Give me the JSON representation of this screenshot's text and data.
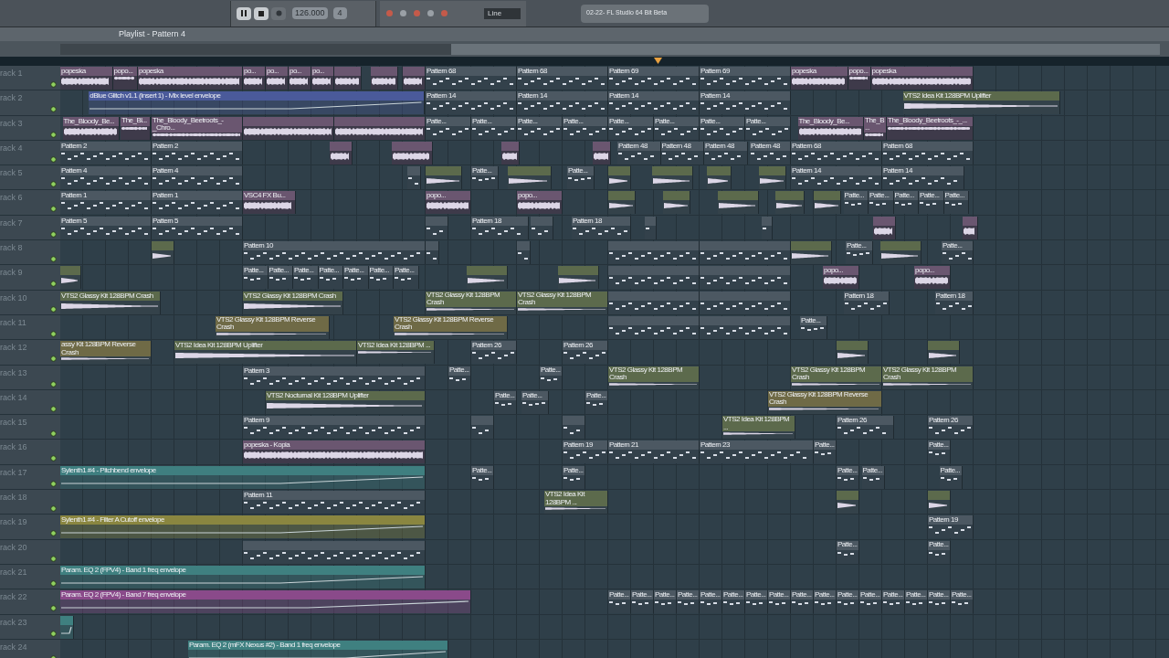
{
  "toolbar": {
    "tempo": "126.000",
    "pattern": "4",
    "snap": "Line",
    "hint": "02-22- FL Studio 64 Bit Beta"
  },
  "playlist": {
    "title": "Playlist - Pattern 4",
    "tracks": [
      {
        "name": "rack 1",
        "clips": [
          {
            "kind": "audio",
            "label": "popeska"
          },
          {
            "kind": "audio",
            "label": "popo..."
          },
          {
            "kind": "audio",
            "label": "popeska"
          },
          {
            "kind": "audio",
            "label": "po..."
          },
          {
            "kind": "audio",
            "label": "po..."
          },
          {
            "kind": "audio",
            "label": "po..."
          },
          {
            "kind": "audio",
            "label": "po..."
          },
          {
            "kind": "audio"
          },
          {
            "kind": "audio"
          },
          {
            "kind": "audio"
          },
          {
            "kind": "pattern",
            "label": "Pattern 68"
          },
          {
            "kind": "pattern",
            "label": "Pattern 68"
          },
          {
            "kind": "pattern",
            "label": "Pattern 69"
          },
          {
            "kind": "pattern",
            "label": "Pattern 69"
          },
          {
            "kind": "audio",
            "label": "popeska"
          },
          {
            "kind": "audio",
            "label": "popo..."
          },
          {
            "kind": "audio",
            "label": "popeska"
          }
        ]
      },
      {
        "name": "rack 2",
        "clips": [
          {
            "kind": "automation",
            "color": "#4a5a9a",
            "label": "dBlue Glitch v1.1 (Insert 1) - Mix level envelope"
          },
          {
            "kind": "pattern",
            "label": "Pattern 14"
          },
          {
            "kind": "pattern",
            "label": "Pattern 14"
          },
          {
            "kind": "pattern",
            "label": "Pattern 14"
          },
          {
            "kind": "pattern",
            "label": "Pattern 14"
          },
          {
            "kind": "sample",
            "label": "VTS2 Idea Kit 128BPM Uplifter"
          }
        ]
      },
      {
        "name": "rack 3",
        "clips": [
          {
            "kind": "audio",
            "label": "The_Bloody_Be..."
          },
          {
            "kind": "audio",
            "label": "The_Bl..."
          },
          {
            "kind": "audio",
            "label": "The_Bloody_Beetroots_-_Chro..."
          },
          {
            "kind": "audio"
          },
          {
            "kind": "audio"
          },
          {
            "kind": "pattern",
            "label": "Patte..."
          },
          {
            "kind": "pattern",
            "label": "Patte..."
          },
          {
            "kind": "pattern",
            "label": "Patte..."
          },
          {
            "kind": "pattern",
            "label": "Patte..."
          },
          {
            "kind": "pattern",
            "label": "Patte..."
          },
          {
            "kind": "pattern",
            "label": "Patte..."
          },
          {
            "kind": "pattern",
            "label": "Patte..."
          },
          {
            "kind": "pattern",
            "label": "Patte..."
          },
          {
            "kind": "audio",
            "label": "The_Bloody_Be..."
          },
          {
            "kind": "audio",
            "label": "The_B..."
          },
          {
            "kind": "audio",
            "label": "The_Bloody_Beetroots_-_..."
          }
        ]
      },
      {
        "name": "rack 4",
        "clips": [
          {
            "kind": "pattern",
            "label": "Pattern 2"
          },
          {
            "kind": "pattern",
            "label": "Pattern 2"
          },
          {
            "kind": "audio"
          },
          {
            "kind": "audio"
          },
          {
            "kind": "audio"
          },
          {
            "kind": "audio"
          },
          {
            "kind": "pattern",
            "label": "Pattern 48"
          },
          {
            "kind": "pattern",
            "label": "Pattern 48"
          },
          {
            "kind": "pattern",
            "label": "Pattern 48"
          },
          {
            "kind": "pattern",
            "label": "Pattern 48"
          },
          {
            "kind": "pattern",
            "label": "Pattern 68"
          },
          {
            "kind": "pattern",
            "label": "Pattern 68"
          }
        ]
      },
      {
        "name": "rack 5",
        "clips": [
          {
            "kind": "pattern",
            "label": "Pattern 4"
          },
          {
            "kind": "pattern",
            "label": "Pattern 4"
          },
          {
            "kind": "pattern"
          },
          {
            "kind": "sample"
          },
          {
            "kind": "pattern",
            "label": "Patte..."
          },
          {
            "kind": "sample"
          },
          {
            "kind": "pattern",
            "label": "Patte..."
          },
          {
            "kind": "sample"
          },
          {
            "kind": "sample"
          },
          {
            "kind": "sample"
          },
          {
            "kind": "sample"
          },
          {
            "kind": "pattern",
            "label": "Pattern 14"
          },
          {
            "kind": "pattern",
            "label": "Pattern 14"
          }
        ]
      },
      {
        "name": "rack 6",
        "clips": [
          {
            "kind": "pattern",
            "label": "Pattern 1"
          },
          {
            "kind": "pattern",
            "label": "Pattern 1"
          },
          {
            "kind": "audio",
            "label": "VSC4 FX Bu..."
          },
          {
            "kind": "audio",
            "label": "popo..."
          },
          {
            "kind": "audio",
            "label": "popo..."
          },
          {
            "kind": "sample"
          },
          {
            "kind": "sample"
          },
          {
            "kind": "sample"
          },
          {
            "kind": "sample"
          },
          {
            "kind": "sample"
          },
          {
            "kind": "pattern",
            "label": "Patte..."
          },
          {
            "kind": "pattern",
            "label": "Patte..."
          },
          {
            "kind": "pattern",
            "label": "Patte..."
          },
          {
            "kind": "pattern",
            "label": "Patte..."
          },
          {
            "kind": "pattern",
            "label": "Patte..."
          }
        ]
      },
      {
        "name": "rack 7",
        "clips": [
          {
            "kind": "pattern",
            "label": "Pattern 5"
          },
          {
            "kind": "pattern",
            "label": "Pattern 5"
          },
          {
            "kind": "pattern"
          },
          {
            "kind": "pattern",
            "label": "Pattern 18"
          },
          {
            "kind": "pattern"
          },
          {
            "kind": "pattern",
            "label": "Pattern 18"
          },
          {
            "kind": "pattern"
          },
          {
            "kind": "pattern"
          },
          {
            "kind": "audio"
          },
          {
            "kind": "audio"
          }
        ]
      },
      {
        "name": "rack 8",
        "clips": [
          {
            "kind": "sample"
          },
          {
            "kind": "pattern",
            "label": "Pattern 10"
          },
          {
            "kind": "pattern"
          },
          {
            "kind": "pattern"
          },
          {
            "kind": "pattern"
          },
          {
            "kind": "pattern"
          },
          {
            "kind": "sample"
          },
          {
            "kind": "pattern",
            "label": "Patte..."
          },
          {
            "kind": "sample"
          },
          {
            "kind": "pattern",
            "label": "Patte..."
          }
        ]
      },
      {
        "name": "rack 9",
        "clips": [
          {
            "kind": "sample"
          },
          {
            "kind": "pattern",
            "label": "Patte..."
          },
          {
            "kind": "pattern",
            "label": "Patte..."
          },
          {
            "kind": "pattern",
            "label": "Patte..."
          },
          {
            "kind": "pattern",
            "label": "Patte..."
          },
          {
            "kind": "pattern",
            "label": "Patte..."
          },
          {
            "kind": "pattern",
            "label": "Patte..."
          },
          {
            "kind": "pattern",
            "label": "Patte..."
          },
          {
            "kind": "sample"
          },
          {
            "kind": "sample"
          },
          {
            "kind": "pattern"
          },
          {
            "kind": "pattern"
          },
          {
            "kind": "audio",
            "label": "popo..."
          },
          {
            "kind": "audio",
            "label": "popo..."
          }
        ]
      },
      {
        "name": "rack 10",
        "clips": [
          {
            "kind": "sample",
            "label": "VTS2 Glassy Kit 128BPM Crash"
          },
          {
            "kind": "sample",
            "label": "VTS2 Glassy Kit 128BPM Crash"
          },
          {
            "kind": "sample",
            "label": "VTS2 Glassy Kit 128BPM Crash"
          },
          {
            "kind": "sample",
            "label": "VTS2 Glassy Kit 128BPM Crash"
          },
          {
            "kind": "pattern"
          },
          {
            "kind": "pattern"
          },
          {
            "kind": "pattern",
            "label": "Pattern 18"
          },
          {
            "kind": "pattern",
            "label": "Pattern 18"
          }
        ]
      },
      {
        "name": "rack 11",
        "clips": [
          {
            "kind": "reverse",
            "label": "VTS2 Glassy Kit 128BPM Reverse Crash"
          },
          {
            "kind": "reverse",
            "label": "VTS2 Glassy Kit 128BPM Reverse Crash"
          },
          {
            "kind": "pattern"
          },
          {
            "kind": "pattern"
          },
          {
            "kind": "pattern",
            "label": "Patte..."
          }
        ]
      },
      {
        "name": "rack 12",
        "clips": [
          {
            "kind": "reverse",
            "label": "assy Kit 128BPM Reverse Crash"
          },
          {
            "kind": "sample",
            "label": "VTS2 Idea Kit 128BPM Uplifter"
          },
          {
            "kind": "sample",
            "label": "VTS2 Idea Kit 128BPM ..."
          },
          {
            "kind": "pattern",
            "label": "Pattern 26"
          },
          {
            "kind": "pattern",
            "label": "Pattern 26"
          },
          {
            "kind": "sample"
          },
          {
            "kind": "sample"
          }
        ]
      },
      {
        "name": "rack 13",
        "clips": [
          {
            "kind": "pattern",
            "label": "Pattern 3"
          },
          {
            "kind": "pattern",
            "label": "Patte..."
          },
          {
            "kind": "pattern",
            "label": "Patte..."
          },
          {
            "kind": "sample",
            "label": "VTS2 Glassy Kit 128BPM Crash"
          },
          {
            "kind": "sample",
            "label": "VTS2 Glassy Kit 128BPM Crash"
          },
          {
            "kind": "sample",
            "label": "VTS2 Glassy Kit 128BPM Crash"
          }
        ]
      },
      {
        "name": "rack 14",
        "clips": [
          {
            "kind": "sample",
            "label": "VTS2 Nocturnal Kit 128BPM Uplifter"
          },
          {
            "kind": "pattern",
            "label": "Patte..."
          },
          {
            "kind": "pattern",
            "label": "Patte..."
          },
          {
            "kind": "pattern",
            "label": "Patte..."
          },
          {
            "kind": "reverse",
            "label": "VTS2 Glassy Kit 128BPM Reverse Crash"
          }
        ]
      },
      {
        "name": "rack 15",
        "clips": [
          {
            "kind": "pattern",
            "label": "Pattern 9"
          },
          {
            "kind": "pattern"
          },
          {
            "kind": "pattern"
          },
          {
            "kind": "sample",
            "label": "VTS2 Idea Kit 128BPM ..."
          },
          {
            "kind": "pattern",
            "label": "Pattern 26"
          },
          {
            "kind": "pattern",
            "label": "Pattern 26"
          }
        ]
      },
      {
        "name": "rack 16",
        "clips": [
          {
            "kind": "audio",
            "label": "popeska - Kopia"
          },
          {
            "kind": "pattern",
            "label": "Pattern 19"
          },
          {
            "kind": "pattern",
            "label": "Pattern 21"
          },
          {
            "kind": "pattern",
            "label": "Pattern 23"
          },
          {
            "kind": "pattern",
            "label": "Patte..."
          },
          {
            "kind": "pattern",
            "label": "Patte..."
          }
        ]
      },
      {
        "name": "rack 17",
        "clips": [
          {
            "kind": "automation",
            "color": "#3f7f80",
            "label": "Sylenth1 #4 - Pitchbend envelope"
          },
          {
            "kind": "pattern",
            "label": "Patte..."
          },
          {
            "kind": "pattern",
            "label": "Patte..."
          },
          {
            "kind": "pattern",
            "label": "Patte..."
          },
          {
            "kind": "pattern",
            "label": "Patte..."
          },
          {
            "kind": "pattern",
            "label": "Patte..."
          }
        ]
      },
      {
        "name": "rack 18",
        "clips": [
          {
            "kind": "pattern",
            "label": "Pattern 11"
          },
          {
            "kind": "sample",
            "label": "VTS2 Idea Kit 128BPM ..."
          },
          {
            "kind": "sample"
          },
          {
            "kind": "sample"
          }
        ]
      },
      {
        "name": "rack 19",
        "clips": [
          {
            "kind": "automation",
            "color": "#8a8640",
            "label": "Sylenth1 #4 - Filter A Cutoff envelope"
          },
          {
            "kind": "pattern",
            "label": "Pattern 19"
          }
        ]
      },
      {
        "name": "rack 20",
        "clips": [
          {
            "kind": "pattern"
          },
          {
            "kind": "pattern",
            "label": "Patte..."
          },
          {
            "kind": "pattern",
            "label": "Patte..."
          }
        ]
      },
      {
        "name": "rack 21",
        "clips": [
          {
            "kind": "automation",
            "color": "#3f8080",
            "label": "Param. EQ 2 (FPV4) - Band 1 freq envelope"
          }
        ]
      },
      {
        "name": "rack 22",
        "clips": [
          {
            "kind": "automation",
            "color": "#8a4a8a",
            "label": "Param. EQ 2 (FPV4) - Band 7 freq envelope"
          },
          {
            "kind": "pattern",
            "label": "Patte..."
          },
          {
            "kind": "pattern",
            "label": "Patte..."
          },
          {
            "kind": "pattern",
            "label": "Patte..."
          },
          {
            "kind": "pattern",
            "label": "Patte..."
          },
          {
            "kind": "pattern",
            "label": "Patte..."
          },
          {
            "kind": "pattern",
            "label": "Patte..."
          },
          {
            "kind": "pattern",
            "label": "Patte..."
          },
          {
            "kind": "pattern",
            "label": "Patte..."
          },
          {
            "kind": "pattern",
            "label": "Patte..."
          },
          {
            "kind": "pattern",
            "label": "Patte..."
          },
          {
            "kind": "pattern",
            "label": "Patte..."
          },
          {
            "kind": "pattern",
            "label": "Patte..."
          },
          {
            "kind": "pattern",
            "label": "Patte..."
          },
          {
            "kind": "pattern",
            "label": "Patte..."
          },
          {
            "kind": "pattern",
            "label": "Patte..."
          },
          {
            "kind": "pattern",
            "label": "Patte..."
          }
        ]
      },
      {
        "name": "rack 23",
        "clips": [
          {
            "kind": "automation",
            "color": "#3f8080"
          }
        ]
      },
      {
        "name": "rack 24",
        "clips": [
          {
            "kind": "automation",
            "color": "#3f8080",
            "label": "Param. EQ 2 (mFX Nexus #2) - Band 1 freq envelope"
          }
        ]
      }
    ]
  }
}
